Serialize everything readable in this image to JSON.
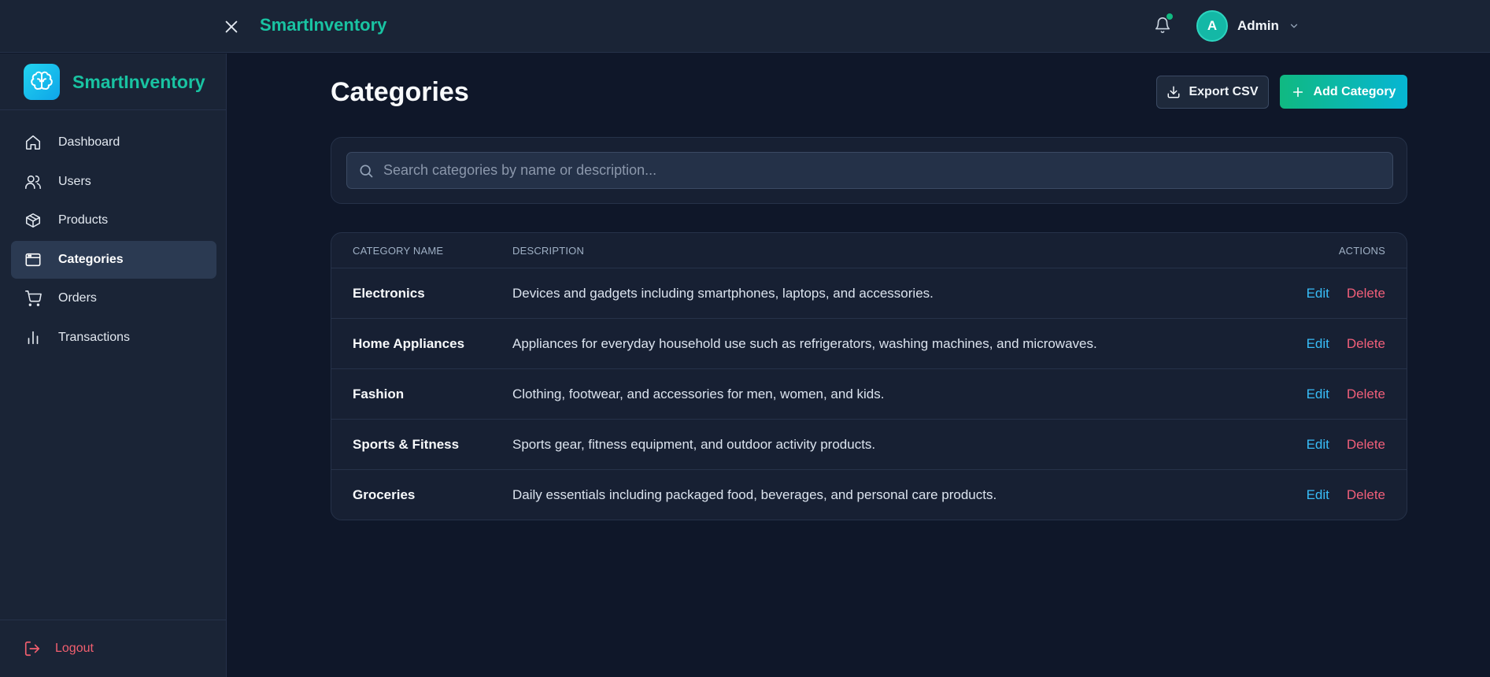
{
  "topbar": {
    "brand": "SmartInventory",
    "user_initial": "A",
    "user_name": "Admin"
  },
  "sidebar": {
    "brand": "SmartInventory",
    "items": [
      {
        "label": "Dashboard",
        "icon": "home-icon"
      },
      {
        "label": "Users",
        "icon": "users-icon"
      },
      {
        "label": "Products",
        "icon": "package-icon"
      },
      {
        "label": "Categories",
        "icon": "window-icon",
        "active": true
      },
      {
        "label": "Orders",
        "icon": "cart-icon"
      },
      {
        "label": "Transactions",
        "icon": "bar-chart-icon"
      }
    ],
    "logout": "Logout"
  },
  "page": {
    "title": "Categories",
    "export_label": "Export CSV",
    "add_label": "Add Category"
  },
  "search": {
    "placeholder": "Search categories by name or description...",
    "value": ""
  },
  "table": {
    "headers": {
      "name": "CATEGORY NAME",
      "description": "DESCRIPTION",
      "actions": "ACTIONS"
    },
    "rows": [
      {
        "name": "Electronics",
        "description": "Devices and gadgets including smartphones, laptops, and accessories.",
        "edit": "Edit",
        "delete": "Delete"
      },
      {
        "name": "Home Appliances",
        "description": "Appliances for everyday household use such as refrigerators, washing machines, and microwaves.",
        "edit": "Edit",
        "delete": "Delete"
      },
      {
        "name": "Fashion",
        "description": "Clothing, footwear, and accessories for men, women, and kids.",
        "edit": "Edit",
        "delete": "Delete"
      },
      {
        "name": "Sports & Fitness",
        "description": "Sports gear, fitness equipment, and outdoor activity products.",
        "edit": "Edit",
        "delete": "Delete"
      },
      {
        "name": "Groceries",
        "description": "Daily essentials including packaged food, beverages, and personal care products.",
        "edit": "Edit",
        "delete": "Delete"
      }
    ]
  },
  "colors": {
    "background": "#0f1729",
    "panel": "#1a2436",
    "brand": "#19c3a2",
    "accent_gradient_start": "#10b981",
    "accent_gradient_end": "#06b6d4",
    "edit": "#38bdf8",
    "delete": "#f25f7a",
    "logout": "#f25f6f"
  }
}
